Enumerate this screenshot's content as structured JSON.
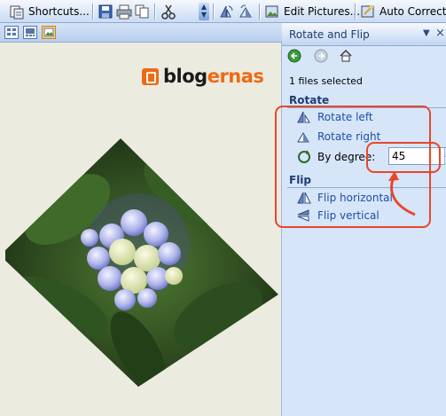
{
  "toolbar": {
    "shortcuts_label": "Shortcuts...",
    "edit_pictures_label": "Edit Pictures...",
    "auto_correct_label": "Auto Correct"
  },
  "logo": {
    "text_main": "blog",
    "text_accent": "ernas",
    "accent_color": "#ee6a13"
  },
  "pane": {
    "title": "Rotate and Flip",
    "files_selected": "1 files selected",
    "rotate_section": "Rotate",
    "rotate_left": "Rotate left",
    "rotate_right": "Rotate right",
    "by_degree_label": "By degree:",
    "by_degree_value": "45",
    "flip_section": "Flip",
    "flip_horizontal": "Flip horizontal",
    "flip_vertical": "Flip vertical"
  },
  "colors": {
    "link": "#1f4fa5",
    "annotation": "#e8462c",
    "pane_bg": "#d6e5f8"
  }
}
